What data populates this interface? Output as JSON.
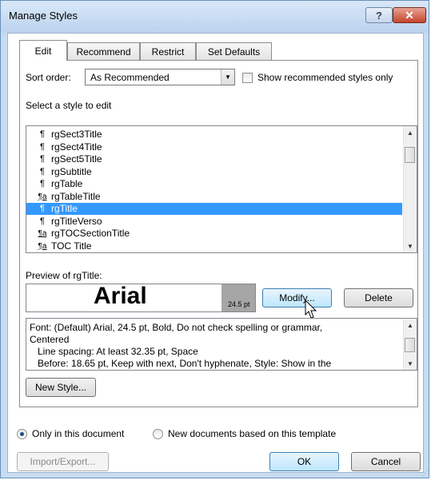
{
  "window": {
    "title": "Manage Styles",
    "help_label": "?",
    "close_label": "✕"
  },
  "tabs": [
    {
      "label": "Edit"
    },
    {
      "label": "Recommend"
    },
    {
      "label": "Restrict"
    },
    {
      "label": "Set Defaults"
    }
  ],
  "sort": {
    "label": "Sort order:",
    "value": "As Recommended"
  },
  "show_recommended": {
    "label": "Show recommended styles only",
    "checked": false
  },
  "list": {
    "label": "Select a style to edit",
    "items": [
      {
        "label": "rgSect3Title",
        "icon": "paragraph-icon",
        "glyph": "¶"
      },
      {
        "label": "rgSect4Title",
        "icon": "paragraph-icon",
        "glyph": "¶"
      },
      {
        "label": "rgSect5Title",
        "icon": "paragraph-icon",
        "glyph": "¶"
      },
      {
        "label": "rgSubtitle",
        "icon": "paragraph-icon",
        "glyph": "¶"
      },
      {
        "label": "rgTable",
        "icon": "paragraph-icon",
        "glyph": "¶"
      },
      {
        "label": "rgTableTitle",
        "icon": "linked-style-icon",
        "glyph": "¶a"
      },
      {
        "label": "rgTitle",
        "icon": "paragraph-icon",
        "glyph": "¶",
        "selected": true
      },
      {
        "label": "rgTitleVerso",
        "icon": "paragraph-icon",
        "glyph": "¶"
      },
      {
        "label": "rgTOCSectionTitle",
        "icon": "linked-style-icon",
        "glyph": "¶a"
      },
      {
        "label": "TOC Title",
        "icon": "linked-style-icon",
        "glyph": "¶a"
      }
    ]
  },
  "preview": {
    "label": "Preview of rgTitle:",
    "font_sample": "Arial",
    "size": "24.5 pt"
  },
  "buttons": {
    "modify": "Modify...",
    "delete": "Delete",
    "new_style": "New Style...",
    "import_export": "Import/Export...",
    "ok": "OK",
    "cancel": "Cancel"
  },
  "description": {
    "lines": [
      "Font: (Default) Arial, 24.5 pt, Bold, Do not check spelling or grammar,",
      "Centered",
      "Line spacing:  At least 32.35 pt, Space",
      "Before:  18.65 pt, Keep with next, Don't hyphenate, Style: Show in the"
    ]
  },
  "scope": {
    "only_doc": "Only in this document",
    "new_docs": "New documents based on this template",
    "selected": "only_doc"
  },
  "colors": {
    "selection": "#3399ff",
    "title_bar": "#c7dcf3"
  }
}
